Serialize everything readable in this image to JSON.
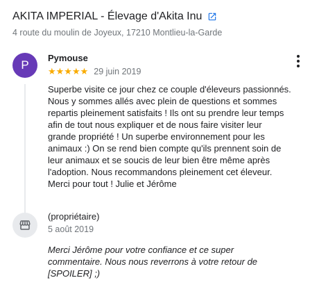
{
  "business": {
    "title": "AKITA IMPERIAL - Élevage d'Akita Inu",
    "address": "4 route du moulin de Joyeux, 17210 Montlieu-la-Garde"
  },
  "review": {
    "avatar_letter": "P",
    "reviewer": "Pymouse",
    "stars": "★★★★★",
    "rating": 5,
    "date": "29 juin 2019",
    "text": "Superbe visite ce jour chez ce couple d'éleveurs passionnés. Nous y sommes allés avec plein de questions et sommes repartis pleinement satisfaits ! Ils ont su prendre leur temps afin de tout nous expliquer et de nous faire visiter leur grande propriété ! Un superbe environnement pour les animaux :) On se rend bien compte qu'ils prennent soin de leur animaux et se soucis de leur bien être même après l'adoption. Nous recommandons pleinement cet éleveur. Merci pour tout ! Julie et Jérôme"
  },
  "owner_reply": {
    "label": "(propriétaire)",
    "date": "5 août 2019",
    "text": "Merci Jérôme pour votre confiance et ce super commentaire. Nous nous reverrons à votre retour de [SPOILER] ;)"
  },
  "colors": {
    "avatar": "#673ab7",
    "stars": "#f9ab00",
    "link_icon": "#1a73e8"
  },
  "icons": {
    "external_link": "open-in-new-icon",
    "menu": "more-vert-icon",
    "owner": "storefront-icon"
  }
}
